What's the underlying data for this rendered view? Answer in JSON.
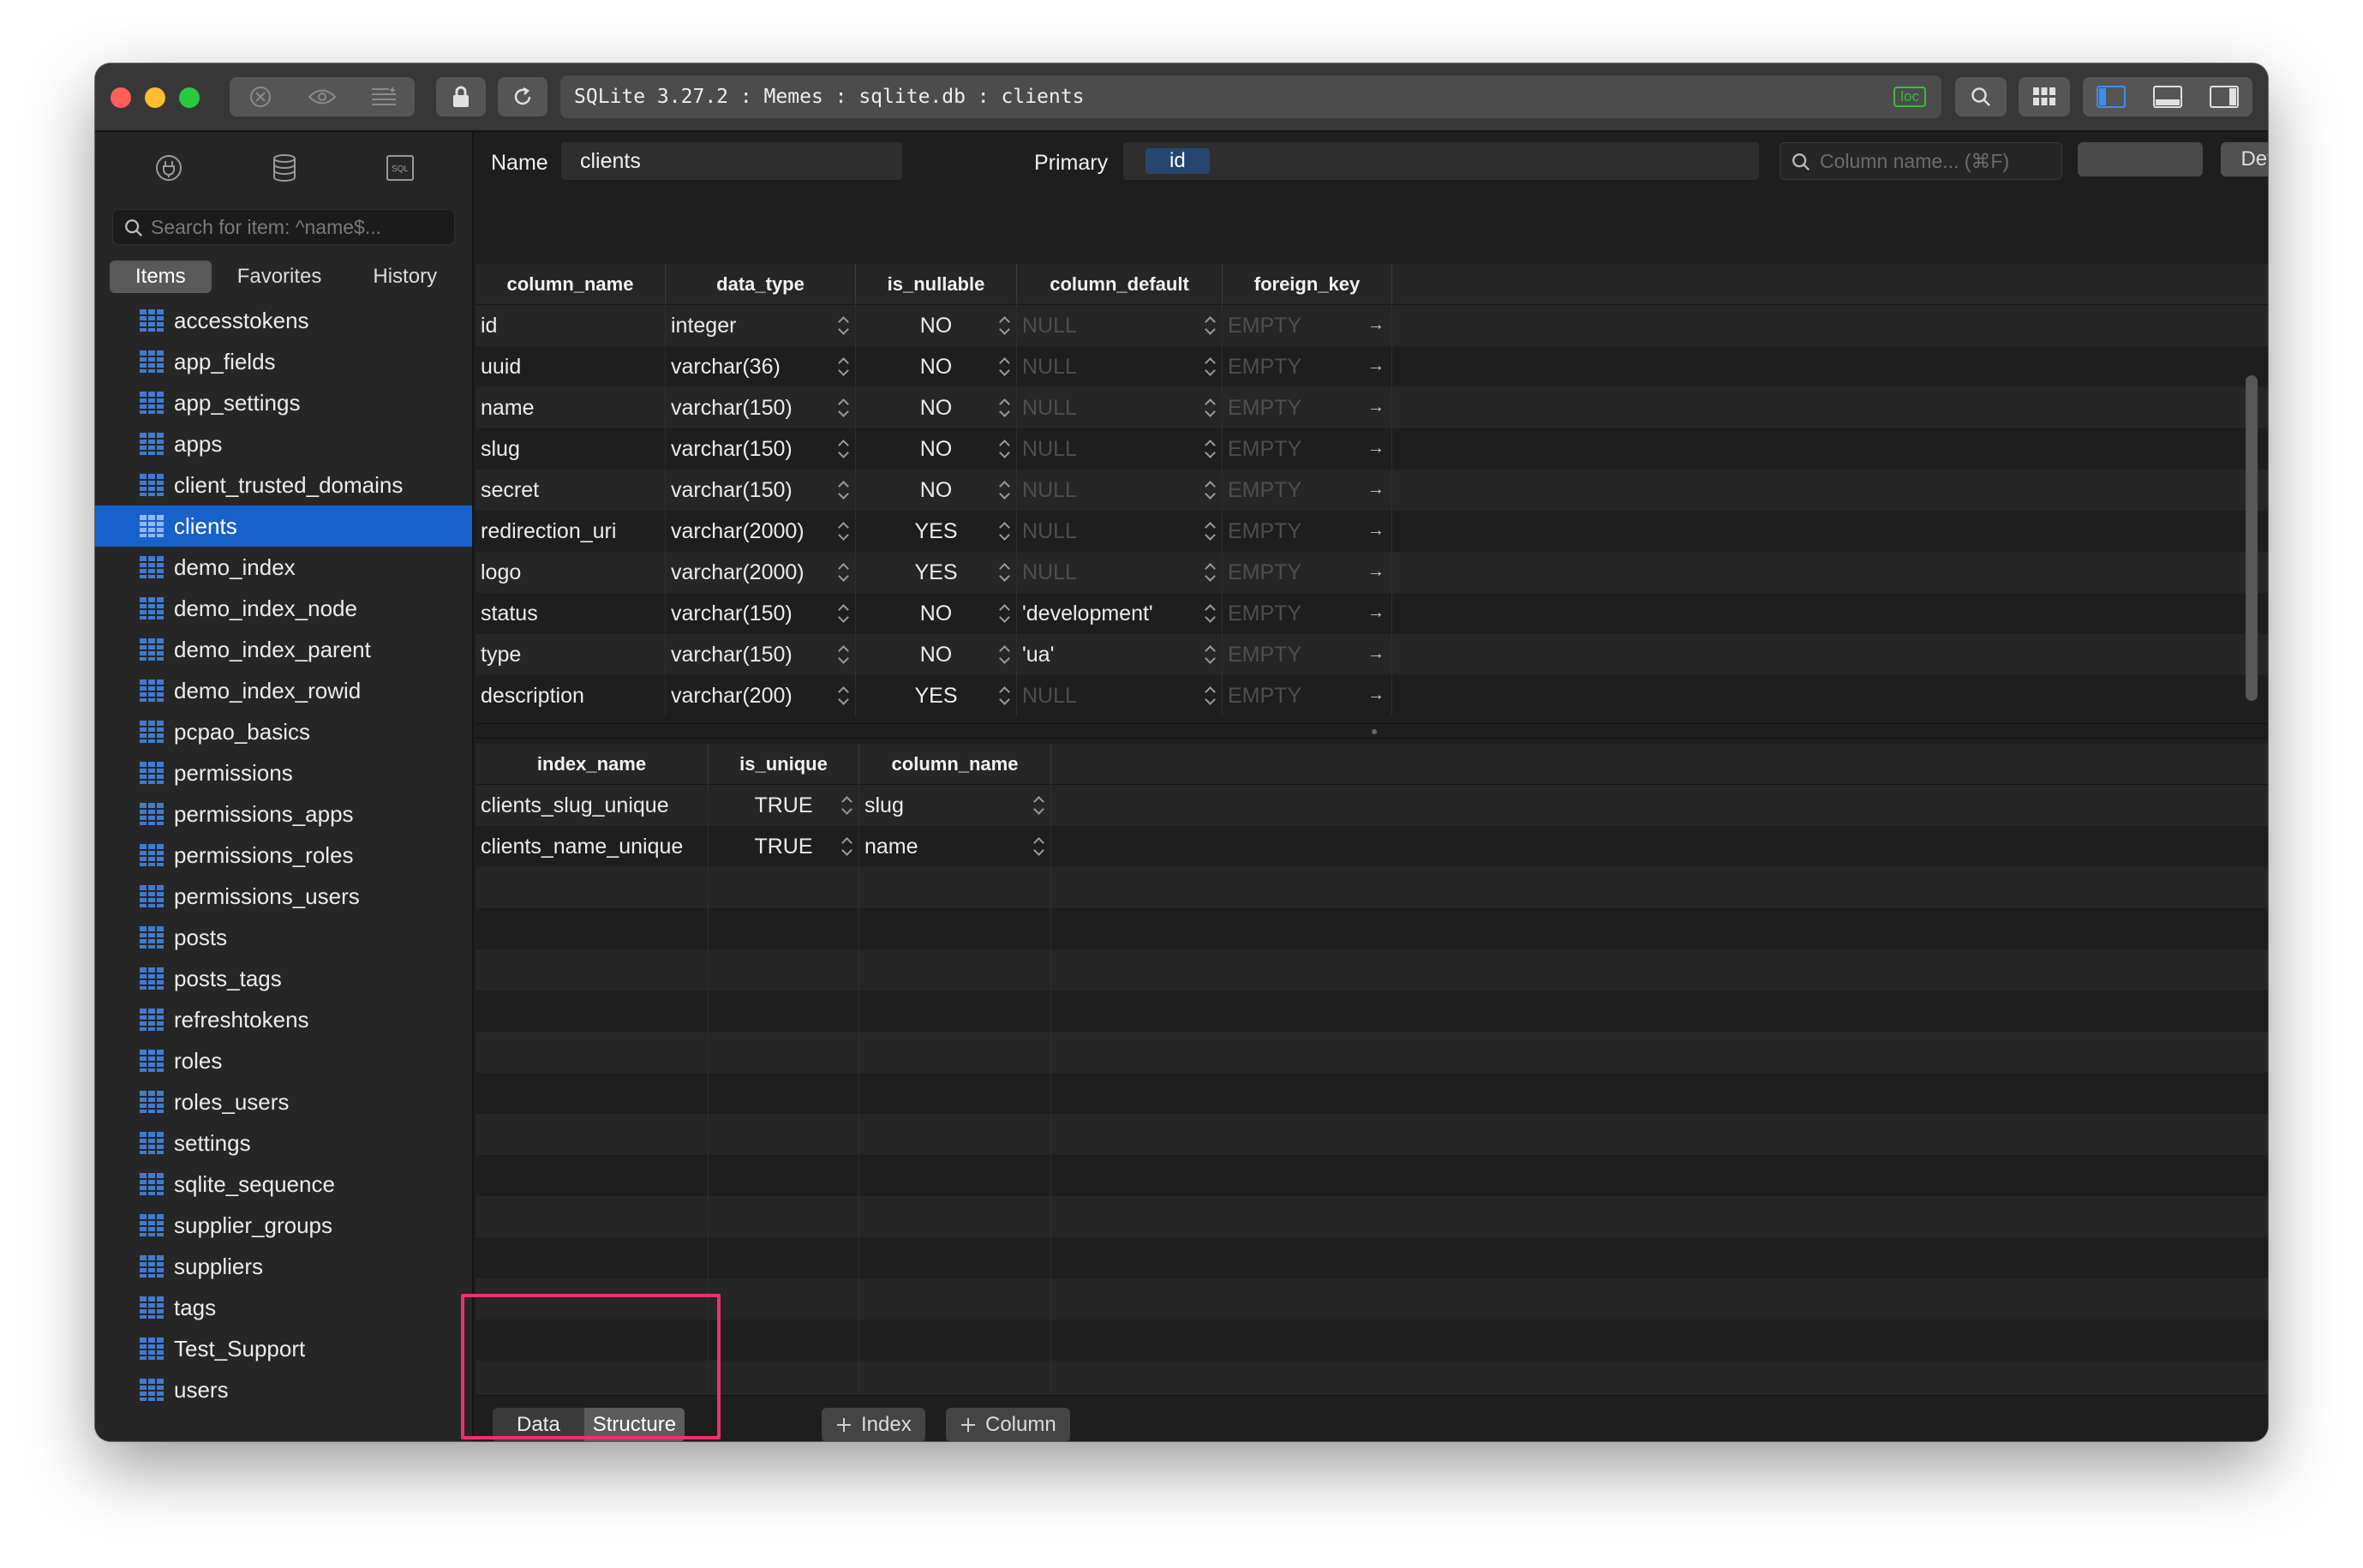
{
  "window": {
    "address": "SQLite 3.27.2 : Memes : sqlite.db : clients",
    "address_badge": "loc"
  },
  "sidebar": {
    "search_placeholder": "Search for item: ^name$...",
    "tabs": [
      "Items",
      "Favorites",
      "History"
    ],
    "active_tab": "Items",
    "items": [
      {
        "label": "accesstokens"
      },
      {
        "label": "app_fields"
      },
      {
        "label": "app_settings"
      },
      {
        "label": "apps"
      },
      {
        "label": "client_trusted_domains"
      },
      {
        "label": "clients",
        "selected": true
      },
      {
        "label": "demo_index"
      },
      {
        "label": "demo_index_node"
      },
      {
        "label": "demo_index_parent"
      },
      {
        "label": "demo_index_rowid"
      },
      {
        "label": "pcpao_basics"
      },
      {
        "label": "permissions"
      },
      {
        "label": "permissions_apps"
      },
      {
        "label": "permissions_roles"
      },
      {
        "label": "permissions_users"
      },
      {
        "label": "posts"
      },
      {
        "label": "posts_tags"
      },
      {
        "label": "refreshtokens"
      },
      {
        "label": "roles"
      },
      {
        "label": "roles_users"
      },
      {
        "label": "settings"
      },
      {
        "label": "sqlite_sequence"
      },
      {
        "label": "supplier_groups"
      },
      {
        "label": "suppliers"
      },
      {
        "label": "tags"
      },
      {
        "label": "Test_Support"
      },
      {
        "label": "users"
      }
    ]
  },
  "header": {
    "name_label": "Name",
    "name_value": "clients",
    "primary_label": "Primary",
    "primary_value": "id",
    "search_placeholder": "Column name... (⌘F)",
    "definition_button": "Definition"
  },
  "columns_table": {
    "headers": [
      "column_name",
      "data_type",
      "is_nullable",
      "column_default",
      "foreign_key"
    ],
    "rows": [
      [
        "id",
        "integer",
        "NO",
        "NULL",
        "EMPTY"
      ],
      [
        "uuid",
        "varchar(36)",
        "NO",
        "NULL",
        "EMPTY"
      ],
      [
        "name",
        "varchar(150)",
        "NO",
        "NULL",
        "EMPTY"
      ],
      [
        "slug",
        "varchar(150)",
        "NO",
        "NULL",
        "EMPTY"
      ],
      [
        "secret",
        "varchar(150)",
        "NO",
        "NULL",
        "EMPTY"
      ],
      [
        "redirection_uri",
        "varchar(2000)",
        "YES",
        "NULL",
        "EMPTY"
      ],
      [
        "logo",
        "varchar(2000)",
        "YES",
        "NULL",
        "EMPTY"
      ],
      [
        "status",
        "varchar(150)",
        "NO",
        "'development'",
        "EMPTY"
      ],
      [
        "type",
        "varchar(150)",
        "NO",
        "'ua'",
        "EMPTY"
      ],
      [
        "description",
        "varchar(200)",
        "YES",
        "NULL",
        "EMPTY"
      ]
    ]
  },
  "indexes_table": {
    "headers": [
      "index_name",
      "is_unique",
      "column_name"
    ],
    "rows": [
      [
        "clients_slug_unique",
        "TRUE",
        "slug"
      ],
      [
        "clients_name_unique",
        "TRUE",
        "name"
      ]
    ]
  },
  "footer": {
    "segments": [
      "Data",
      "Structure"
    ],
    "active_segment": "Structure",
    "add_index": "Index",
    "add_column": "Column"
  },
  "colors": {
    "accent": "#1861ca",
    "highlight": "#f0306a",
    "loc_badge": "#3dbb3d"
  }
}
